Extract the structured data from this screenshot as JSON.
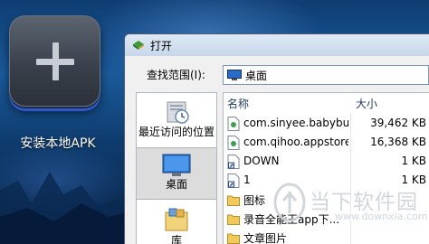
{
  "desktop": {
    "app_label": "安装本地APK"
  },
  "dialog": {
    "title": "打开",
    "look_in_label": "查找范围(I):",
    "look_in_value": "桌面",
    "places": [
      {
        "label": "最近访问的位置"
      },
      {
        "label": "桌面"
      },
      {
        "label": "库"
      }
    ],
    "columns": {
      "name": "名称",
      "size": "大小"
    },
    "files": [
      {
        "name": "com.sinyee.babybus...",
        "size": "39,462 KB",
        "icon": "apk-file-icon"
      },
      {
        "name": "com.qihoo.appstore...",
        "size": "16,368 KB",
        "icon": "apk-file-icon"
      },
      {
        "name": "DOWN",
        "size": "1 KB",
        "icon": "shortcut-icon"
      },
      {
        "name": "1",
        "size": "1 KB",
        "icon": "shortcut-icon"
      },
      {
        "name": "图标",
        "size": "",
        "icon": "folder-icon"
      },
      {
        "name": "录音全能王app下...",
        "size": "",
        "icon": "folder-icon"
      },
      {
        "name": "文章图片",
        "size": "",
        "icon": "folder-icon"
      }
    ]
  },
  "watermark": {
    "title": "当下软件园",
    "url": "www.downxia.com"
  },
  "colors": {
    "desktop_top": "#0f3d72",
    "tile_glow": "#2f58c6",
    "dialog_frame": "#cfdcec",
    "header_text": "#1e395b"
  }
}
